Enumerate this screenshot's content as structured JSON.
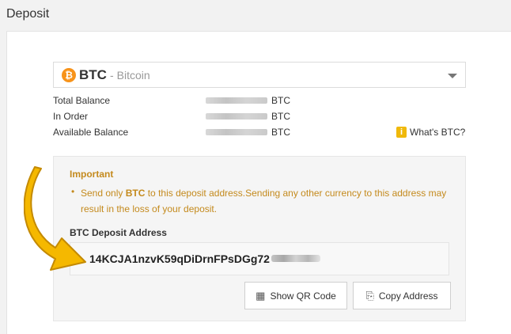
{
  "page": {
    "title": "Deposit"
  },
  "currency_select": {
    "icon": "bitcoin-coin-icon",
    "icon_glyph": "₿",
    "code": "BTC",
    "separator": "-",
    "name": "Bitcoin"
  },
  "balances": [
    {
      "label": "Total Balance",
      "unit": "BTC"
    },
    {
      "label": "In Order",
      "unit": "BTC"
    },
    {
      "label": "Available Balance",
      "unit": "BTC"
    }
  ],
  "whats_btc": {
    "icon_glyph": "i",
    "label": "What's BTC?"
  },
  "important": {
    "title": "Important",
    "bullet": "•",
    "prefix": "Send only ",
    "currency": "BTC",
    "suffix": " to this deposit address.Sending any other currency to this address may result in the loss of your deposit."
  },
  "deposit_address": {
    "label": "BTC Deposit Address",
    "visible_address": "14KCJA1nzvK59qDiDrnFPsDGg72"
  },
  "buttons": {
    "qr": {
      "icon": "qr-code-icon",
      "icon_glyph": "▦",
      "label": "Show QR Code"
    },
    "copy": {
      "icon": "copy-icon",
      "icon_glyph": "⎘",
      "label": "Copy Address"
    }
  },
  "colors": {
    "accent_orange": "#f7931a",
    "warning_text": "#c48a1d",
    "info_icon": "#f0b90b",
    "annotation_arrow": "#f5b800"
  }
}
